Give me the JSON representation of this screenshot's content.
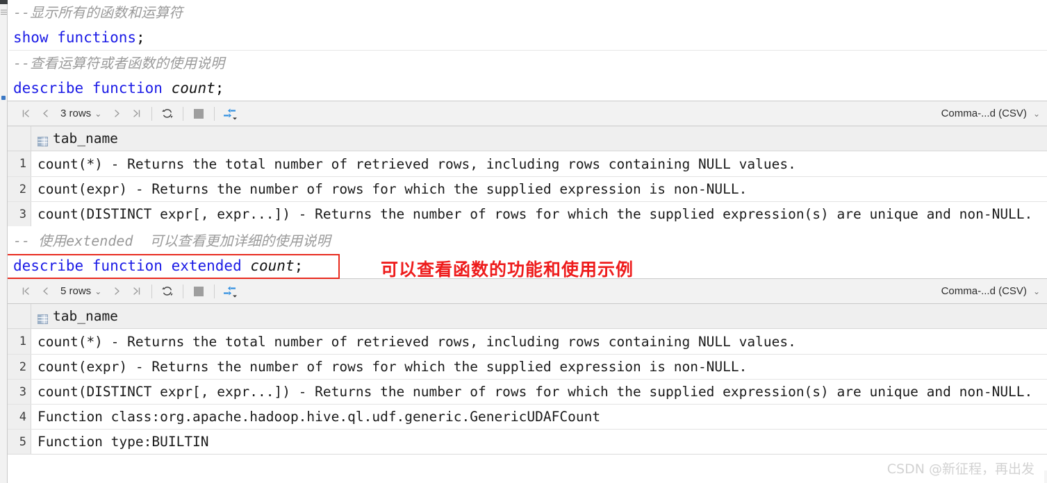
{
  "editor": {
    "lines": [
      {
        "kind": "comment",
        "text": "--显示所有的函数和运算符"
      },
      {
        "kind": "sql",
        "keyword": "show functions",
        "ident": "",
        "punct": ";"
      },
      {
        "kind": "comment",
        "text": "--查看运算符或者函数的使用说明"
      },
      {
        "kind": "sql",
        "keyword": "describe function ",
        "ident": "count",
        "punct": ";"
      }
    ],
    "comment1": "--显示所有的函数和运算符",
    "sql1_kw": "show functions",
    "sql1_punc": ";",
    "comment2": "--查看运算符或者函数的使用说明",
    "sql2_kw": "describe function ",
    "sql2_ident": "count",
    "sql2_punc": ";",
    "comment3": "-- 使用extended  可以查看更加详细的使用说明",
    "sql3_kw": "describe function extended ",
    "sql3_ident": "count",
    "sql3_punc": ";"
  },
  "annotation": {
    "red_note": "可以查看函数的功能和使用示例",
    "box_color": "#e8291c",
    "note_color": "#ee1c1c"
  },
  "result1": {
    "toolbar": {
      "first_icon": "|<",
      "prev_icon": "<",
      "rows_label": "3 rows",
      "rows_chevron": "⌄",
      "next_icon": ">",
      "last_icon": ">|",
      "refresh_icon": "refresh",
      "stop_icon": "stop",
      "transpose_icon": "transpose",
      "format_label": "Comma-...d (CSV)",
      "format_chevron": "⌄"
    },
    "column_header": "tab_name",
    "rows": [
      {
        "n": "1",
        "value": "count(*) - Returns the total number of retrieved rows, including rows containing NULL values."
      },
      {
        "n": "2",
        "value": "count(expr) - Returns the number of rows for which the supplied expression is non-NULL."
      },
      {
        "n": "3",
        "value": "count(DISTINCT expr[, expr...]) - Returns the number of rows for which the supplied expression(s) are unique and non-NULL."
      }
    ]
  },
  "result2": {
    "toolbar": {
      "first_icon": "|<",
      "prev_icon": "<",
      "rows_label": "5 rows",
      "rows_chevron": "⌄",
      "next_icon": ">",
      "last_icon": ">|",
      "refresh_icon": "refresh",
      "stop_icon": "stop",
      "transpose_icon": "transpose",
      "format_label": "Comma-...d (CSV)",
      "format_chevron": "⌄"
    },
    "column_header": "tab_name",
    "rows": [
      {
        "n": "1",
        "value": "count(*) - Returns the total number of retrieved rows, including rows containing NULL values."
      },
      {
        "n": "2",
        "value": "count(expr) - Returns the number of rows for which the supplied expression is non-NULL."
      },
      {
        "n": "3",
        "value": "count(DISTINCT expr[, expr...]) - Returns the number of rows for which the supplied expression(s) are unique and non-NULL."
      },
      {
        "n": "4",
        "value": "Function class:org.apache.hadoop.hive.ql.udf.generic.GenericUDAFCount"
      },
      {
        "n": "5",
        "value": "Function type:BUILTIN"
      }
    ]
  },
  "watermark": "CSDN @新征程，再出发",
  "colors": {
    "sql_keyword": "#1a1ae6",
    "comment": "#9a9a9a",
    "toolbar_bg": "#f2f2f2",
    "grid_header_bg": "#efefef",
    "accent_blue": "#3b8fe0"
  }
}
